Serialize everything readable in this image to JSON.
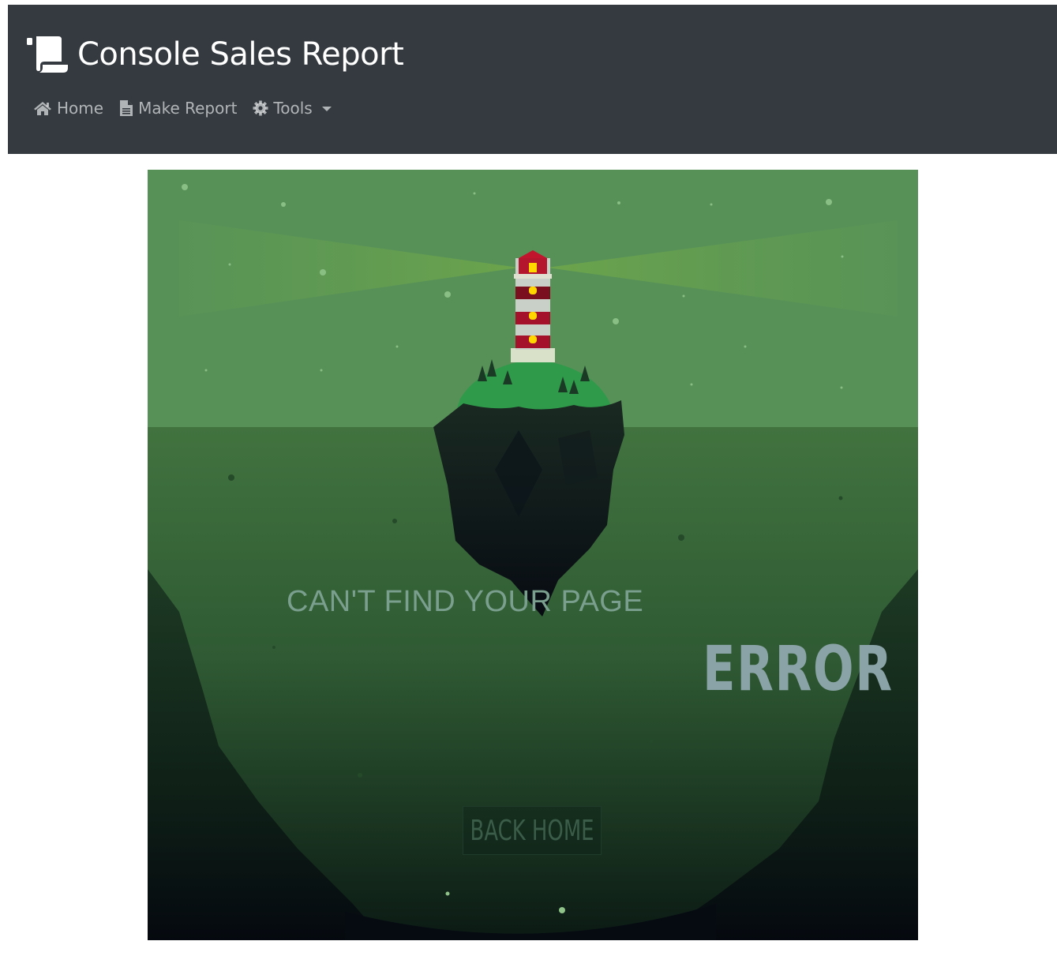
{
  "app": {
    "brand_title": "Console Sales Report",
    "brand_icon": "scroll-icon"
  },
  "nav": {
    "home_label": "Home",
    "home_icon": "home-icon",
    "make_report_label": "Make Report",
    "make_report_icon": "file-icon",
    "tools_label": "Tools",
    "tools_icon": "gear-icon"
  },
  "error_page": {
    "message": "CAN'T FIND YOUR PAGE",
    "title": "ERROR",
    "back_home_label": "BACK HOME",
    "illustration": "lighthouse-on-floating-island"
  },
  "colors": {
    "navbar_bg": "#343a40",
    "sky_green": "#579157",
    "sea_green": "#3e7341",
    "deep": "#060a12"
  }
}
